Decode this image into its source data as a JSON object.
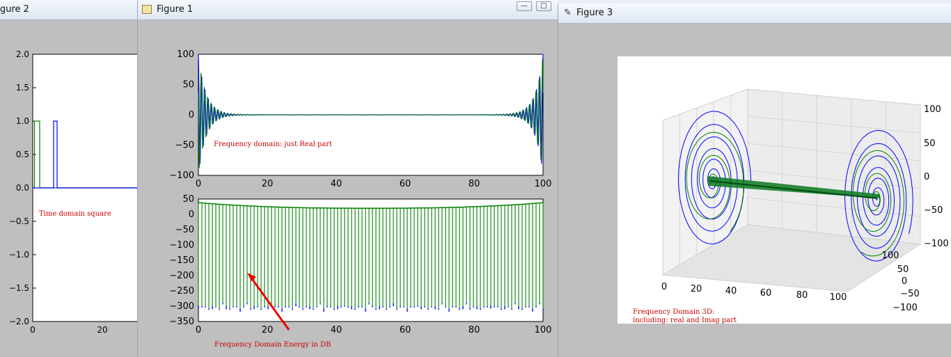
{
  "windows": {
    "fig2": {
      "title": "gure 2"
    },
    "fig1": {
      "title": "Figure 1"
    },
    "fig3": {
      "title": "Figure 3"
    }
  },
  "chart_data": [
    {
      "type": "line",
      "id": "time-domain",
      "ylim": [
        -2.0,
        2.0
      ],
      "yticks": [
        "2.0",
        "1.5",
        "1.0",
        "0.5",
        "0.0",
        "−0.5",
        "−1.0",
        "−1.5",
        "−2.0"
      ],
      "xticks": [
        "0",
        "20"
      ],
      "annotation": "Time domain square",
      "series": [
        {
          "color": "#008000",
          "points": [
            [
              0,
              0
            ],
            [
              0.5,
              0
            ],
            [
              0.5,
              1
            ],
            [
              2,
              1
            ],
            [
              2,
              0
            ],
            [
              40,
              0
            ]
          ]
        },
        {
          "color": "#0000ff",
          "points": [
            [
              0,
              0
            ],
            [
              6,
              0
            ],
            [
              6,
              1
            ],
            [
              7,
              1
            ],
            [
              7,
              0
            ],
            [
              40,
              0
            ]
          ]
        }
      ]
    },
    {
      "type": "line",
      "id": "frequency-real",
      "xlim": [
        0,
        100
      ],
      "ylim": [
        -100,
        100
      ],
      "xticks": [
        "0",
        "20",
        "40",
        "60",
        "80",
        "100"
      ],
      "yticks": [
        "100",
        "50",
        "0",
        "−50",
        "−100"
      ],
      "annotation": "Frequency domain:  just Real part"
    },
    {
      "type": "line",
      "id": "frequency-energy-db",
      "xlim": [
        0,
        100
      ],
      "ylim": [
        -350,
        50
      ],
      "xticks": [
        "0",
        "20",
        "40",
        "60",
        "80",
        "100"
      ],
      "yticks": [
        "50",
        "0",
        "−50",
        "−100",
        "−150",
        "−200",
        "−250",
        "−300",
        "−350"
      ],
      "annotation": "Frequency Domain Energy in DB"
    },
    {
      "type": "line",
      "id": "frequency-3d",
      "xticks": [
        "0",
        "20",
        "40",
        "60",
        "80",
        "100"
      ],
      "yticks": [
        "100",
        "50",
        "0",
        "−50",
        "−100"
      ],
      "zticks": [
        "100",
        "50",
        "0",
        "−50",
        "−100"
      ],
      "annotation_line1": "Frequency Domain 3D:",
      "annotation_line2": "including: real and Imag part"
    }
  ]
}
